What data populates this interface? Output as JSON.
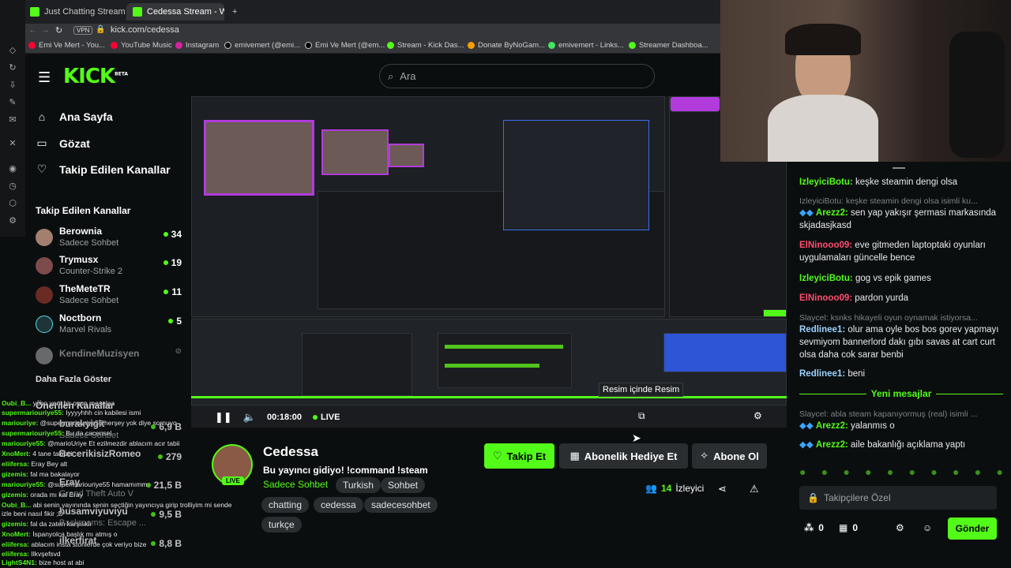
{
  "browser": {
    "tabs": [
      {
        "label": "Just Chatting Streaming -"
      },
      {
        "label": "Cedessa Stream - Wat"
      }
    ],
    "new_tab": "+",
    "url": "kick.com/cedessa",
    "bookmarks": [
      "Emi Ve Mert - You...",
      "YouTube Music",
      "Instagram",
      "emivemert (@emi...",
      "Emi Ve Mert (@em...",
      "Stream - Kick Das...",
      "Donate ByNoGam...",
      "emivemert - Links...",
      "Streamer Dashboa..."
    ]
  },
  "header": {
    "logo": "KICK",
    "logo_badge": "BETA",
    "search_placeholder": "Ara"
  },
  "sidebar": {
    "nav": [
      {
        "label": "Ana Sayfa",
        "icon": "home-icon"
      },
      {
        "label": "Gözat",
        "icon": "browse-icon"
      },
      {
        "label": "Takip Edilen Kanallar",
        "icon": "heart-icon"
      }
    ],
    "followed_title": "Takip Edilen Kanallar",
    "channels": [
      {
        "name": "Berownia",
        "category": "Sadece Sohbet",
        "viewers": "34"
      },
      {
        "name": "Trymusx",
        "category": "Counter-Strike 2",
        "viewers": "19"
      },
      {
        "name": "TheMeteTR",
        "category": "Sadece Sohbet",
        "viewers": "11"
      },
      {
        "name": "Noctborn",
        "category": "Marvel Rivals",
        "viewers": "5"
      },
      {
        "name": "KendineMuzisyen",
        "category": "",
        "viewers": ""
      }
    ],
    "show_more": "Daha Fazla Göster",
    "recommended_title": "Önerilen Kanallar",
    "recommended": [
      {
        "name": "burakyigit",
        "category": "Sadece Sohbet",
        "viewers": "6,9 B"
      },
      {
        "name": "BecerikisizRomeo",
        "category": "",
        "viewers": "279"
      },
      {
        "name": "Eray",
        "category": "Grand Theft Auto V",
        "viewers": "21,5 B"
      },
      {
        "name": "husamviyuviyu",
        "category": "Backrooms: Escape ...",
        "viewers": "9,5 B"
      },
      {
        "name": "ilkerfirat",
        "category": "",
        "viewers": "8,8 B"
      }
    ]
  },
  "player": {
    "time": "00:18:00",
    "live": "LIVE",
    "tooltip": "Resim içinde Resim"
  },
  "stream": {
    "streamer": "Cedessa",
    "live_badge": "LIVE",
    "title": "Bu yayıncı gidiyo! !command !steam",
    "category": "Sadece Sohbet",
    "tags": [
      "Turkish",
      "Sohbet",
      "chatting",
      "cedessa",
      "sadecesohbet",
      "turkçe"
    ],
    "follow_btn": "Takip Et",
    "gift_btn": "Abonelik Hediye Et",
    "sub_btn": "Abone Ol",
    "viewers": "14",
    "viewers_label": "İzleyici"
  },
  "chat": {
    "messages": [
      {
        "user": "IzleyiciBotu:",
        "text": "keşke steamin dengi olsa",
        "color": "#53fc18",
        "sys": false
      },
      {
        "user": "",
        "text": "IzleyiciBotu: keşke steamin dengi olsa isimli ku...",
        "color": "#7d8286",
        "sys": true
      },
      {
        "user": "Arezz2:",
        "text": "sen yap yakışır şermasi markasında skjadasjkasd",
        "color": "#53fc18",
        "sys": false
      },
      {
        "user": "ElNinooo09:",
        "text": "eve gitmeden laptoptaki oyunları uygulamaları güncelle bence",
        "color": "#ff4d6d",
        "sys": false
      },
      {
        "user": "IzleyiciBotu:",
        "text": "gog vs epik games",
        "color": "#53fc18",
        "sys": false
      },
      {
        "user": "ElNinooo09:",
        "text": "pardon yurda",
        "color": "#ff4d6d",
        "sys": false
      },
      {
        "user": "",
        "text": "Slaycel: ksnks hikayeli oyun oynamak istiyorsa...",
        "color": "#7d8286",
        "sys": true
      },
      {
        "user": "Redlinee1:",
        "text": "olur ama oyle bos bos gorev yapmayı sevmiyom bannerlord dakı gıbı savas at cart curt olsa daha cok sarar benbi",
        "color": "#9ad3ff",
        "sys": false
      },
      {
        "user": "Redlinee1:",
        "text": "beni",
        "color": "#9ad3ff",
        "sys": false
      },
      {
        "user": "",
        "text": "Slaycel: abla steam kapanıyormuş (real) isimli ...",
        "color": "#7d8286",
        "sys": true
      },
      {
        "user": "Arezz2:",
        "text": "yalanmıs o",
        "color": "#53fc18",
        "sys": false
      },
      {
        "user": "Arezz2:",
        "text": "aile bakanlığı açıklama yaptı",
        "color": "#53fc18",
        "sys": false
      }
    ],
    "new_messages": "Yeni mesajlar",
    "input_placeholder": "Takipçilere Özel",
    "kicks_count": "0",
    "gifts_count": "0",
    "send_btn": "Gönder"
  },
  "overlay_chat": [
    {
      "user": "Oubi_B...",
      "text": "yooo yeni bir oyun meselaa"
    },
    {
      "user": "supermariouriye55:",
      "text": "Iyyyyhhh cin kabilesi ismi"
    },
    {
      "user": "mariouriye:",
      "text": "@supermariouriye55 herşey yok diye sornuyo"
    },
    {
      "user": "supermariouriye55:",
      "text": "Bu da cacensel"
    },
    {
      "user": "mariouriye55:",
      "text": "@marioUriye Et ezilmezdir ablacım acır tabii"
    },
    {
      "user": "XnoMert:",
      "text": "4 tane takipci"
    },
    {
      "user": "eliifersa:",
      "text": "Eray Bey alt"
    },
    {
      "user": "gizemis:",
      "text": "fal ma bakalayor"
    },
    {
      "user": "mariouriye55:",
      "text": "@supermariouriye55 hamamımm"
    },
    {
      "user": "gizemis:",
      "text": "orada mı kal Eray"
    },
    {
      "user": "Oubi_B...",
      "text": "abi senin yayınında senin seçtiğin yayıncıya girip trolliyim mi sende"
    },
    {
      "user": "",
      "text": "izle beni nasıl fikir ;D"
    },
    {
      "user": "gizemis:",
      "text": "fal da zaten karşılıklı"
    },
    {
      "user": "XnoMert:",
      "text": "İspanyolca başlık mı atmış o"
    },
    {
      "user": "eliifersa:",
      "text": "ablacım insta storilerde çok veriyo bize"
    },
    {
      "user": "eliifersa:",
      "text": "Ilkvşefsvd"
    },
    {
      "user": "LightS4N1:",
      "text": "bize host at abi"
    }
  ]
}
